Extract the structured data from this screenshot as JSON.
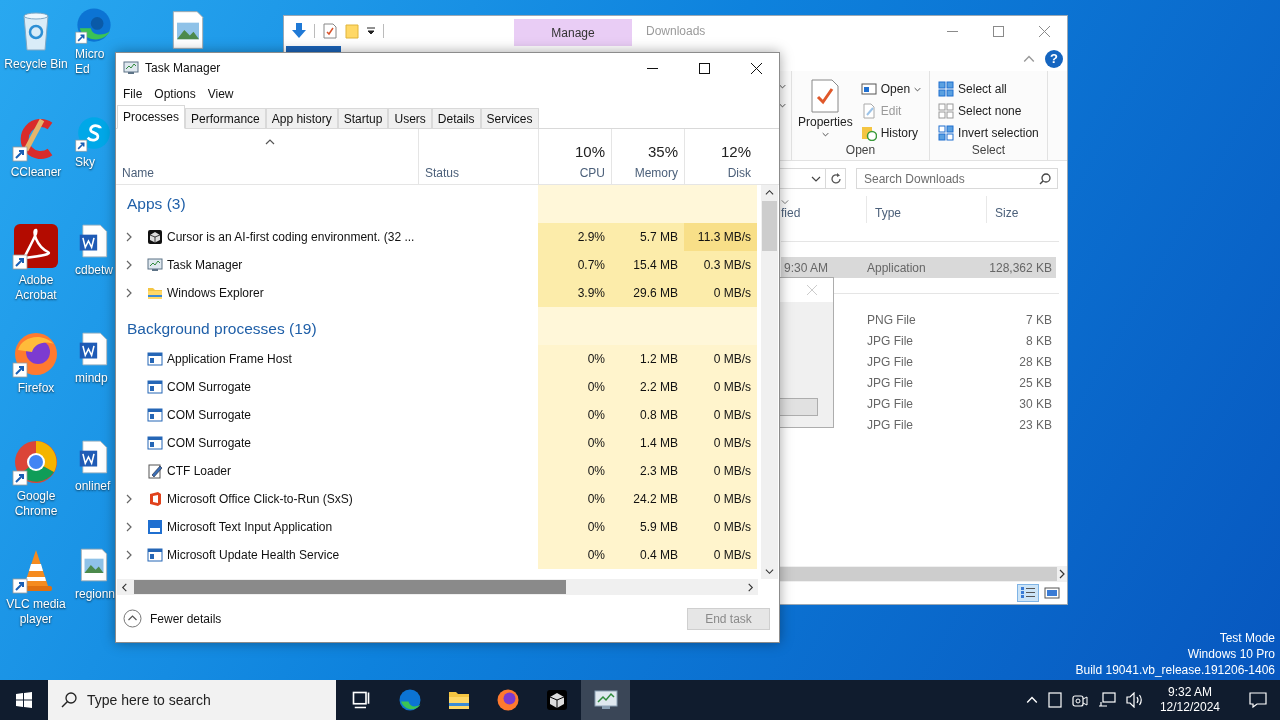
{
  "desktop": {
    "icons": [
      {
        "kind": "trash",
        "shortcut": false,
        "lines": [
          "Recycle Bin"
        ]
      },
      {
        "kind": "cleaner",
        "shortcut": true,
        "lines": [
          "CCleaner"
        ]
      },
      {
        "kind": "pdf",
        "shortcut": true,
        "lines": [
          "Adobe",
          "Acrobat"
        ]
      },
      {
        "kind": "fox",
        "shortcut": true,
        "lines": [
          "Firefox"
        ]
      },
      {
        "kind": "chrome",
        "shortcut": true,
        "lines": [
          "Google",
          "Chrome"
        ]
      },
      {
        "kind": "cone",
        "shortcut": true,
        "lines": [
          "VLC media",
          "player"
        ]
      },
      {
        "kind": "edge",
        "shortcut": true,
        "lines": [
          "Micro",
          "Ed"
        ]
      },
      {
        "kind": "skype",
        "shortcut": true,
        "lines": [
          "Sky"
        ]
      },
      {
        "kind": "doc",
        "shortcut": false,
        "lines": [
          "cdbetw"
        ]
      },
      {
        "kind": "doc",
        "shortcut": false,
        "lines": [
          "mindp"
        ]
      },
      {
        "kind": "doc",
        "shortcut": false,
        "lines": [
          "onlinef"
        ]
      },
      {
        "kind": "image",
        "shortcut": false,
        "lines": [
          "regionn"
        ]
      }
    ],
    "loose_icon": {
      "kind": "image",
      "shortcut": false
    },
    "info": [
      "Test Mode",
      "Windows 10 Pro",
      "Build 19041.vb_release.191206-1406"
    ]
  },
  "explorer": {
    "context_tab": "Manage",
    "title": "Downloads",
    "help": "?",
    "ribbon": {
      "open_group": {
        "big_button": "Properties",
        "label": "Open",
        "items": [
          {
            "label": "Open",
            "kind": "open",
            "disabled": false,
            "dropdown": true
          },
          {
            "label": "Edit",
            "kind": "edit",
            "disabled": true,
            "dropdown": false
          },
          {
            "label": "History",
            "kind": "history",
            "disabled": false,
            "dropdown": false
          }
        ]
      },
      "select_group": {
        "label": "Select",
        "items": [
          {
            "label": "Select all",
            "kind": "all"
          },
          {
            "label": "Select none",
            "kind": "none"
          },
          {
            "label": "Invert selection",
            "kind": "invert"
          }
        ]
      }
    },
    "search": {
      "placeholder": "Search Downloads"
    },
    "columns": [
      {
        "label": "fied",
        "sorted": true
      },
      {
        "label": "Type",
        "sorted": false
      },
      {
        "label": "Size",
        "sorted": false
      }
    ],
    "groups": [
      {
        "rows": [
          {
            "date": "9:30 AM",
            "type": "Application",
            "size": "128,362 KB",
            "selected": true
          }
        ]
      },
      {
        "rows": [
          {
            "type": "PNG File",
            "size": "7 KB",
            "selected": false
          },
          {
            "type": "JPG File",
            "size": "8 KB",
            "selected": false
          },
          {
            "type": "JPG File",
            "size": "28 KB",
            "selected": false
          },
          {
            "type": "JPG File",
            "size": "25 KB",
            "selected": false
          },
          {
            "type": "JPG File",
            "size": "30 KB",
            "selected": false
          },
          {
            "type": "JPG File",
            "size": "23 KB",
            "selected": false
          }
        ]
      }
    ],
    "view_buttons": [
      {
        "kind": "details",
        "selected": true
      },
      {
        "kind": "tiles",
        "selected": false
      }
    ]
  },
  "task_manager": {
    "title": "Task Manager",
    "menu": [
      "File",
      "Options",
      "View"
    ],
    "tabs": [
      {
        "label": "Processes",
        "selected": true
      },
      {
        "label": "Performance",
        "selected": false
      },
      {
        "label": "App history",
        "selected": false
      },
      {
        "label": "Startup",
        "selected": false
      },
      {
        "label": "Users",
        "selected": false
      },
      {
        "label": "Details",
        "selected": false
      },
      {
        "label": "Services",
        "selected": false
      }
    ],
    "columns": [
      {
        "label": "Name",
        "sorted": true
      },
      {
        "label": "Status",
        "sorted": false
      },
      {
        "label": "CPU",
        "usage": "10%",
        "sorted": false
      },
      {
        "label": "Memory",
        "usage": "35%",
        "sorted": false
      },
      {
        "label": "Disk",
        "usage": "12%",
        "sorted": false
      }
    ],
    "groups": [
      {
        "title": "Apps (3)",
        "rows": [
          {
            "name": "Cursor is an AI-first coding environment. (32 ...",
            "kind": "cube",
            "expandable": true,
            "cells": [
              {
                "text": "2.9%",
                "color": "#fcecaa"
              },
              {
                "text": "5.7 MB",
                "color": "#fcecaa"
              },
              {
                "text": "11.3 MB/s",
                "color": "#f8df88"
              }
            ]
          },
          {
            "name": "Task Manager",
            "kind": "monitor",
            "expandable": true,
            "cells": [
              {
                "text": "0.7%",
                "color": "#fcecaa"
              },
              {
                "text": "15.4 MB",
                "color": "#fcecaa"
              },
              {
                "text": "0.3 MB/s",
                "color": "#fcecaa"
              }
            ]
          },
          {
            "name": "Windows Explorer",
            "kind": "folder",
            "expandable": true,
            "cells": [
              {
                "text": "3.9%",
                "color": "#fcecaa"
              },
              {
                "text": "29.6 MB",
                "color": "#fcecaa"
              },
              {
                "text": "0 MB/s",
                "color": "#fcecaa"
              }
            ]
          }
        ]
      },
      {
        "title": "Background processes (19)",
        "rows": [
          {
            "name": "Application Frame Host",
            "kind": "frame",
            "expandable": false,
            "cells": [
              {
                "text": "0%",
                "color": "#fff4cc"
              },
              {
                "text": "1.2 MB",
                "color": "#fff4cc"
              },
              {
                "text": "0 MB/s",
                "color": "#fff4cc"
              }
            ]
          },
          {
            "name": "COM Surrogate",
            "kind": "frame",
            "expandable": false,
            "cells": [
              {
                "text": "0%",
                "color": "#fff4cc"
              },
              {
                "text": "2.2 MB",
                "color": "#fff4cc"
              },
              {
                "text": "0 MB/s",
                "color": "#fff4cc"
              }
            ]
          },
          {
            "name": "COM Surrogate",
            "kind": "frame",
            "expandable": false,
            "cells": [
              {
                "text": "0%",
                "color": "#fff4cc"
              },
              {
                "text": "0.8 MB",
                "color": "#fff4cc"
              },
              {
                "text": "0 MB/s",
                "color": "#fff4cc"
              }
            ]
          },
          {
            "name": "COM Surrogate",
            "kind": "frame",
            "expandable": false,
            "cells": [
              {
                "text": "0%",
                "color": "#fff4cc"
              },
              {
                "text": "1.4 MB",
                "color": "#fff4cc"
              },
              {
                "text": "0 MB/s",
                "color": "#fff4cc"
              }
            ]
          },
          {
            "name": "CTF Loader",
            "kind": "pen",
            "expandable": false,
            "cells": [
              {
                "text": "0%",
                "color": "#fff4cc"
              },
              {
                "text": "2.3 MB",
                "color": "#fff4cc"
              },
              {
                "text": "0 MB/s",
                "color": "#fff4cc"
              }
            ]
          },
          {
            "name": "Microsoft Office Click-to-Run (SxS)",
            "kind": "office",
            "expandable": true,
            "cells": [
              {
                "text": "0%",
                "color": "#fff4cc"
              },
              {
                "text": "24.2 MB",
                "color": "#fff4cc"
              },
              {
                "text": "0 MB/s",
                "color": "#fff4cc"
              }
            ]
          },
          {
            "name": "Microsoft Text Input Application",
            "kind": "panel",
            "expandable": true,
            "cells": [
              {
                "text": "0%",
                "color": "#fff4cc"
              },
              {
                "text": "5.9 MB",
                "color": "#fff4cc"
              },
              {
                "text": "0 MB/s",
                "color": "#fff4cc"
              }
            ]
          },
          {
            "name": "Microsoft Update Health Service",
            "kind": "frame",
            "expandable": true,
            "cells": [
              {
                "text": "0%",
                "color": "#fff4cc"
              },
              {
                "text": "0.4 MB",
                "color": "#fff4cc"
              },
              {
                "text": "0 MB/s",
                "color": "#fff4cc"
              }
            ]
          }
        ]
      }
    ],
    "footer": {
      "toggle": "Fewer details",
      "end_task": {
        "label": "End task",
        "disabled": true
      }
    }
  },
  "taskbar": {
    "search": {
      "placeholder": "Type here to search"
    },
    "apps": [
      {
        "kind": "taskview",
        "active": false
      },
      {
        "kind": "edge",
        "active": false
      },
      {
        "kind": "folder",
        "active": false
      },
      {
        "kind": "fox",
        "active": false
      },
      {
        "kind": "cube",
        "active": false
      },
      {
        "kind": "monitor",
        "active": true
      }
    ],
    "clock": {
      "time": "9:32 AM",
      "date": "12/12/2024"
    }
  }
}
